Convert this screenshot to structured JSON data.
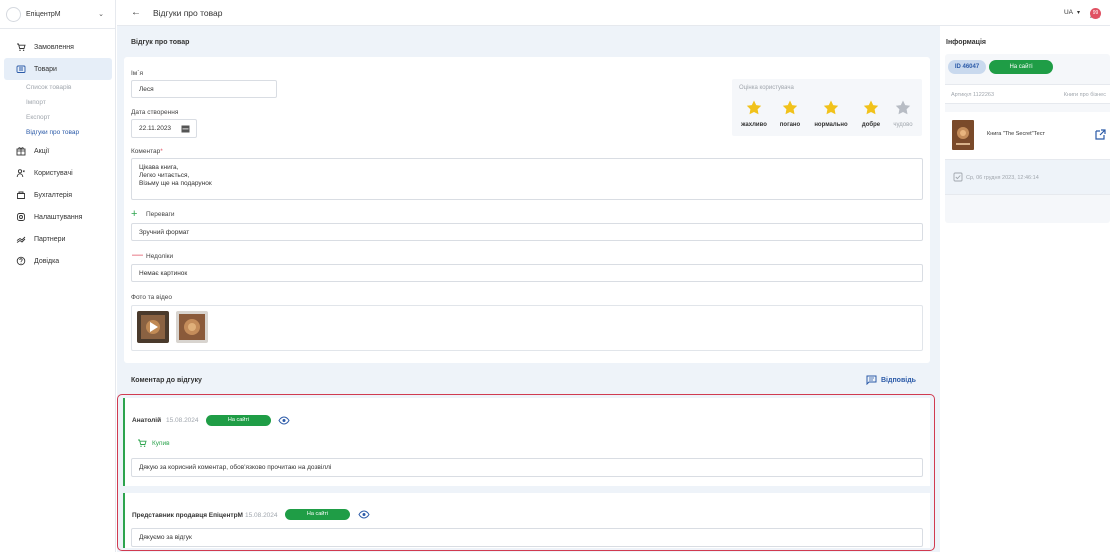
{
  "sidebar": {
    "brand": "ЕпіцентрМ",
    "items": [
      {
        "label": "Замовлення",
        "icon": "cart-icon"
      },
      {
        "label": "Товари",
        "icon": "products-icon",
        "active": true
      },
      {
        "label": "Акції",
        "icon": "promo-icon"
      },
      {
        "label": "Користувачі",
        "icon": "users-icon"
      },
      {
        "label": "Бухгалтерія",
        "icon": "accounting-icon"
      },
      {
        "label": "Налаштування",
        "icon": "settings-icon"
      },
      {
        "label": "Партнери",
        "icon": "partners-icon"
      },
      {
        "label": "Довідка",
        "icon": "help-icon"
      }
    ],
    "subitems": [
      {
        "label": "Список товарів"
      },
      {
        "label": "Імпорт"
      },
      {
        "label": "Експорт"
      },
      {
        "label": "Відгуки про товар",
        "active": true
      }
    ]
  },
  "header": {
    "title": "Відгуки про товар",
    "lang": "UA",
    "notif_count": "99"
  },
  "review": {
    "section_title": "Відгук про товар",
    "name_label": "Ім`я",
    "name_value": "Леся",
    "date_label": "Дата створення",
    "date_value": "22.11.2023",
    "comment_label": "Коментар",
    "comment_required": "*",
    "comment_lines": [
      "Цікава книга,",
      "Легко читається,",
      "Візьму ще на подарунок"
    ],
    "pros_label": "Переваги",
    "pros_value": "Зручний формат",
    "cons_label": "Недоліки",
    "cons_value": "Немає картинок",
    "photos_label": "Фото та відео",
    "rating": {
      "title": "Оцінка користувача",
      "value": 4,
      "max": 5,
      "labels": [
        "жахливо",
        "погано",
        "нормально",
        "добре",
        "чудово"
      ]
    }
  },
  "replies": {
    "section_title": "Коментар до відгуку",
    "reply_button": "Відповідь",
    "items": [
      {
        "author": "Анатолій",
        "date": "15.08.2024",
        "status": "На сайті",
        "bought": "Купив",
        "text": "Дякую за корисний коментар, обов'язково прочитаю на дозвіллі"
      },
      {
        "author": "Представник продавця ЕпіцентрМ",
        "date": "15.08.2024",
        "status": "На сайті",
        "text": "Дякуємо за відгук"
      }
    ]
  },
  "info": {
    "title": "Інформація",
    "id": "ID 46047",
    "status": "На сайті",
    "article": "Артикул 1122263",
    "article_link": "Книги про бізнес",
    "product_name": "Книга \"The Secret\"Тест",
    "timestamp": "Ср, 06 грудня 2023, 12:46:14"
  },
  "colors": {
    "accent": "#2b5aa8",
    "success": "#1f9d46",
    "danger": "#d03a50",
    "star_active": "#f1c21b",
    "star_inactive": "#b7bcc4"
  }
}
